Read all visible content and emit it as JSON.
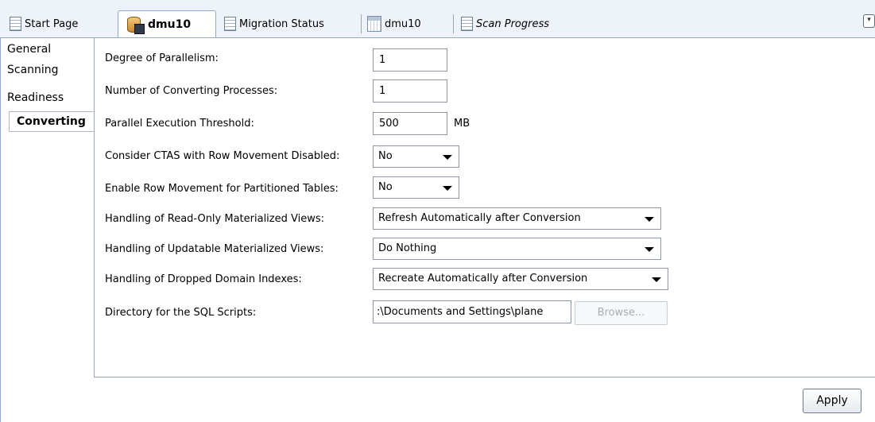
{
  "tabs": [
    {
      "label": "Start Page",
      "icon": "document-icon"
    },
    {
      "label": "dmu10",
      "icon": "database-icon",
      "active": true
    },
    {
      "label": "Migration Status",
      "icon": "document-icon"
    },
    {
      "label": "dmu10",
      "icon": "calendar-icon"
    },
    {
      "label": "Scan Progress",
      "icon": "document-icon"
    }
  ],
  "overflow_glyph": "▾",
  "nav": {
    "items": [
      "General",
      "Scanning",
      "Readiness",
      "Converting"
    ],
    "active_index": 3
  },
  "form": {
    "degree_label": "Degree of Parallelism:",
    "degree_value": "1",
    "procs_label": "Number of Converting Processes:",
    "procs_value": "1",
    "threshold_label": "Parallel Execution Threshold:",
    "threshold_value": "500",
    "threshold_unit": "MB",
    "ctas_label": "Consider CTAS with Row Movement Disabled:",
    "ctas_value": "No",
    "rowmove_label": "Enable Row Movement for Partitioned Tables:",
    "rowmove_value": "No",
    "readonly_mv_label": "Handling of Read-Only Materialized Views:",
    "readonly_mv_value": "Refresh Automatically after Conversion",
    "updatable_mv_label": "Handling of Updatable Materialized Views:",
    "updatable_mv_value": "Do Nothing",
    "domain_idx_label": "Handling of Dropped Domain Indexes:",
    "domain_idx_value": "Recreate Automatically after Conversion",
    "dir_label": "Directory for the SQL Scripts:",
    "dir_value": ":\\Documents and Settings\\plane",
    "browse_label": "Browse..."
  },
  "apply_label": "Apply"
}
